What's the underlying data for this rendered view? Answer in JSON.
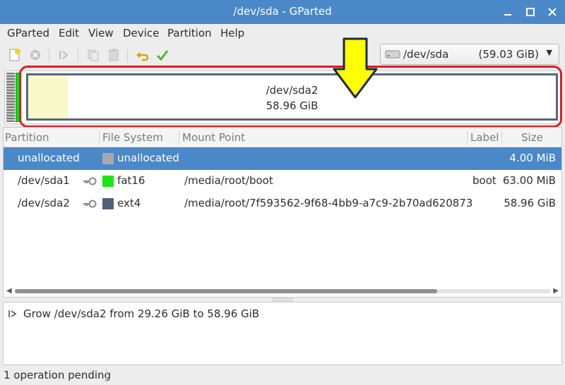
{
  "window": {
    "title": "/dev/sda - GParted"
  },
  "menu": [
    "GParted",
    "Edit",
    "View",
    "Device",
    "Partition",
    "Help"
  ],
  "toolbar": {
    "icons": [
      "new-icon",
      "delete-icon",
      "resize-icon",
      "copy-icon",
      "paste-icon",
      "undo-icon",
      "apply-icon"
    ]
  },
  "device": {
    "name": "/dev/sda",
    "size": "(59.03 GiB)"
  },
  "diskmap": {
    "partition_label": "/dev/sda2",
    "partition_size": "58.96 GiB",
    "colors": {
      "unallocated": "#a0a0a0",
      "fat16": "#19d919",
      "ext4": "#55677a",
      "used": "#f8f8c8",
      "highlight": "#e21b23",
      "arrow": "#ffff00"
    }
  },
  "table": {
    "headers": [
      "Partition",
      "File System",
      "Mount Point",
      "Label",
      "Size"
    ],
    "rows": [
      {
        "partition": "unallocated",
        "fs": "unallocated",
        "fs_color": "#a8a8a8",
        "mount": "",
        "label": "",
        "size": "4.00 MiB",
        "key": false,
        "selected": true
      },
      {
        "partition": "/dev/sda1",
        "fs": "fat16",
        "fs_color": "#19e619",
        "mount": "/media/root/boot",
        "label": "boot",
        "size": "63.00 MiB",
        "key": true,
        "selected": false
      },
      {
        "partition": "/dev/sda2",
        "fs": "ext4",
        "fs_color": "#4d6278",
        "mount": "/media/root/7f593562-9f68-4bb9-a7c9-2b70ad620873",
        "label": "",
        "size": "58.96 GiB",
        "key": true,
        "selected": false
      }
    ]
  },
  "operations": [
    "Grow /dev/sda2 from 29.26 GiB to 58.96 GiB"
  ],
  "status": "1 operation pending"
}
